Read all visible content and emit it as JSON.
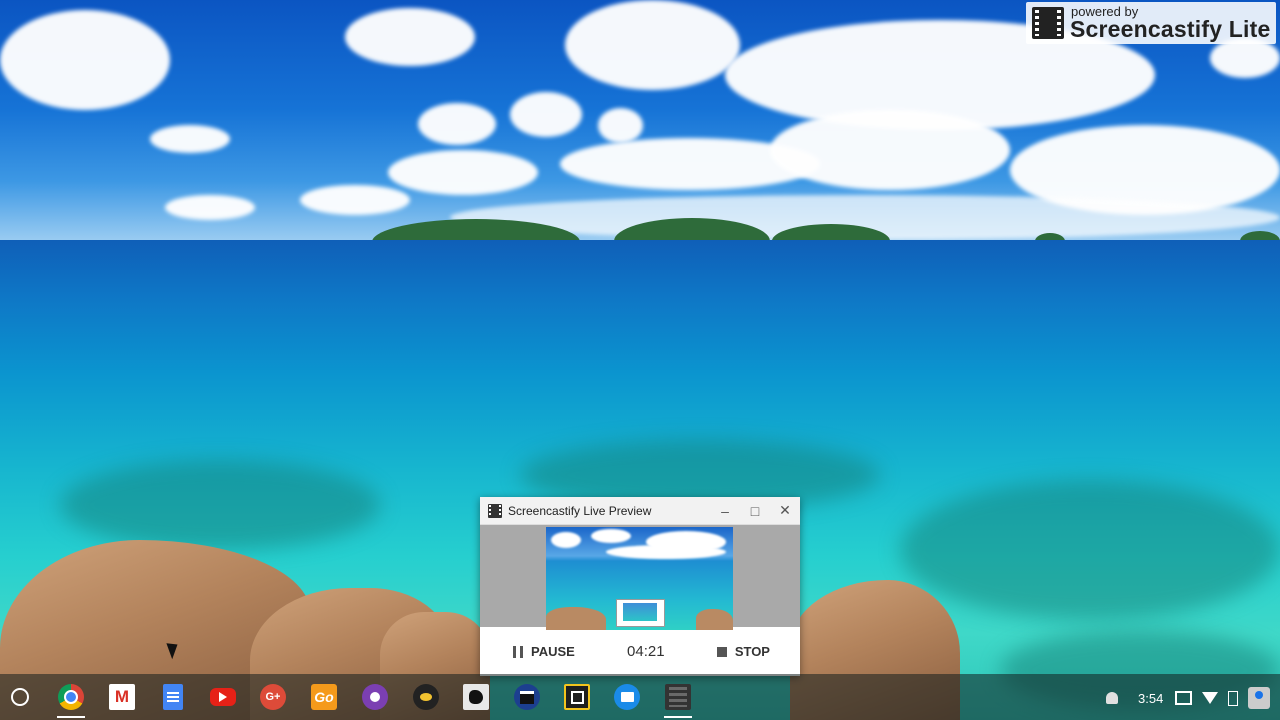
{
  "watermark": {
    "small": "powered by",
    "big": "Screencastify Lite"
  },
  "preview_window": {
    "title": "Screencastify Live Preview",
    "pause_label": "PAUSE",
    "timer": "04:21",
    "stop_label": "STOP",
    "minimize_glyph": "–",
    "maximize_glyph": "□",
    "close_glyph": "✕"
  },
  "shelf": {
    "apps": [
      {
        "name": "chrome-icon"
      },
      {
        "name": "gmail-icon",
        "glyph": "M"
      },
      {
        "name": "docs-icon"
      },
      {
        "name": "youtube-icon"
      },
      {
        "name": "google-plus-icon",
        "glyph": "G+"
      },
      {
        "name": "go-app-icon",
        "glyph": "Go"
      },
      {
        "name": "camera-app-icon"
      },
      {
        "name": "witch-app-icon"
      },
      {
        "name": "ink-app-icon"
      },
      {
        "name": "clapper-app-icon"
      },
      {
        "name": "square-app-icon"
      },
      {
        "name": "files-icon"
      },
      {
        "name": "screencastify-icon"
      }
    ]
  },
  "status": {
    "time": "3:54"
  },
  "colors": {
    "sky": "#1673d6",
    "sea": "#26cfcf",
    "shelf": "#121e1e"
  }
}
